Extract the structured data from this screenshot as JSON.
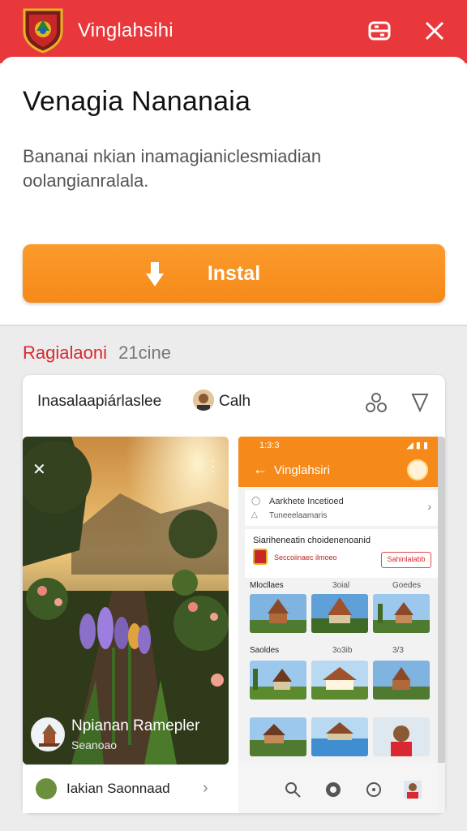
{
  "header": {
    "title": "Vinglahsihi",
    "emblem_icon": "emblem-shield",
    "menu_icon": "menu-icon",
    "close_icon": "close-icon"
  },
  "main": {
    "title": "Venagia Nananaia",
    "description": "Bananai nkian inamagianiclesmiadian oolangianralala.",
    "install_label": "Instal"
  },
  "section": {
    "label": "Ragialaoni",
    "count": "21cine"
  },
  "preview": {
    "title": "Inasalaapiárlaslee",
    "user": "Calh",
    "photo": {
      "name": "Npianan Ramepler",
      "sub": "Seanoao",
      "footer": "Iakian Saonnaad"
    },
    "phone": {
      "status_time": "1:3:3",
      "bar_title": "Vinglahsiri",
      "list_line1": "Aarkhete Incetioed",
      "list_line2": "Tuneeelaamaris",
      "card_title": "Siariheneatin choidenenoanid",
      "card_tag": "Seccoiinaec ilmoeo",
      "card_button": "Sahinlalabb",
      "sec1": {
        "label": "Mlocllaes",
        "mid": "3oial",
        "right": "Goedes"
      },
      "sec2": {
        "label": "Saoldes",
        "mid": "3o3ib",
        "right": "3/3"
      }
    }
  },
  "colors": {
    "brand_red": "#e8383b",
    "install_orange": "#f58a1a",
    "section_red": "#d9282f"
  }
}
